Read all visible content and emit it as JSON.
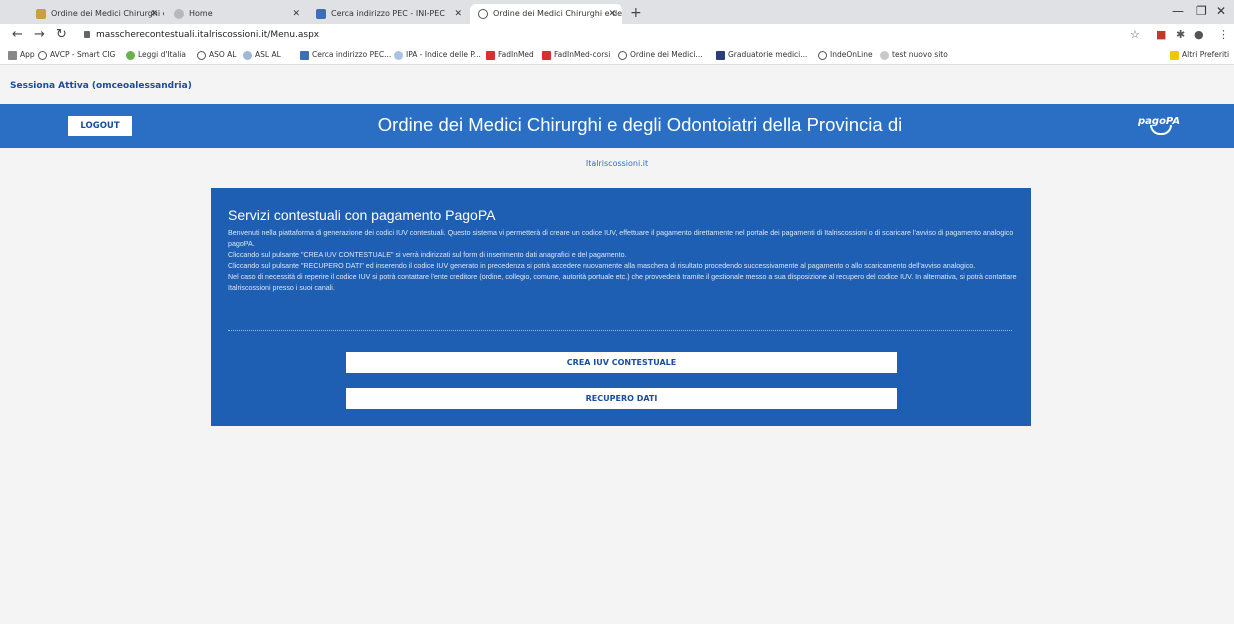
{
  "browser": {
    "tabs": [
      {
        "title": "Ordine dei Medici Chirurghi e de",
        "icon": "medical-logo-icon"
      },
      {
        "title": "Home",
        "icon": "loading-icon"
      },
      {
        "title": "Cerca indirizzo PEC - INI-PEC",
        "icon": "inipec-icon"
      },
      {
        "title": "Ordine dei Medici Chirurghi e de",
        "icon": "globe-icon"
      }
    ],
    "address": "masscherecontestuali.italriscossioni.it/Menu.aspx",
    "bookmarks": [
      "App",
      "AVCP - Smart CIG",
      "Leggi d'Italia",
      "ASO AL",
      "ASL AL",
      "Cerca indirizzo PEC...",
      "IPA - Indice delle P...",
      "FadInMed",
      "FadInMed-corsi",
      "Ordine dei Medici...",
      "Graduatorie medici...",
      "IndeOnLine",
      "test nuovo sito",
      "Altri Preferiti"
    ]
  },
  "page": {
    "session": "Sessiona Attiva (omceoalessandria)",
    "logout_label": "LOGOUT",
    "header_title": "Ordine dei Medici Chirurghi e degli Odontoiatri della Provincia di",
    "pagopa_label": "pagoPA",
    "site_link": "Italriscossioni.it",
    "panel": {
      "title": "Servizi contestuali con pagamento PagoPA",
      "paragraphs": [
        "Benvenuti nella piattaforma di generazione dei codici IUV contestuali. Questo sistema vi permetterà di creare un codice IUV, effettuare il pagamento direttamente nel portale dei pagamenti di Italriscossioni o di scaricare l'avviso di pagamento analogico pagoPA.",
        "Cliccando sul pulsante \"CREA IUV CONTESTUALE\" si verrà indirizzati sul form di inserimento dati anagrafici e del pagamento.",
        "Cliccando sul pulsante \"RECUPERO DATI\" ed inserendo il codice IUV generato in precedenza si potrà accedere nuovamente alla maschera di risultato procedendo successivamente al pagamento o allo scaricamento dell'avviso analogico.",
        "Nel caso di necessità di reperire il codice IUV si potrà contattare l'ente creditore (ordine, collegio, comune, autorità portuale etc.) che provvederà tramite il gestionale messo a sua disposizione al recupero del codice IUV. In alternativa, si potrà contattare Italriscossioni presso i suoi canali."
      ],
      "buttons": {
        "create": "CREA IUV CONTESTUALE",
        "recover": "RECUPERO DATI"
      }
    }
  },
  "colors": {
    "header_blue": "#2a6fc4",
    "panel_blue": "#1f5fb3",
    "link_blue": "#1a4d9c"
  }
}
